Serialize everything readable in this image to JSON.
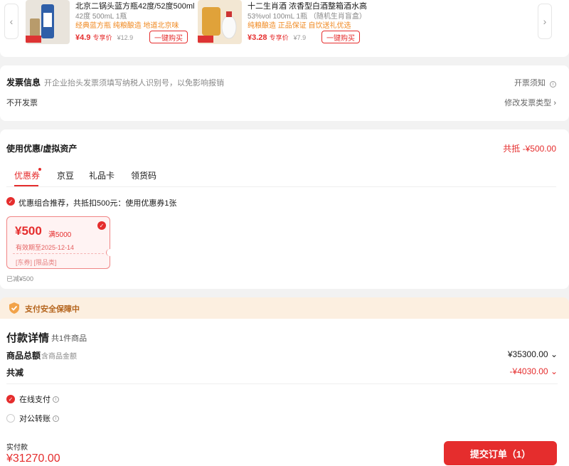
{
  "recommendations": [
    {
      "name": "北京二锅头蓝方瓶42度/52度500ml",
      "spec": "42度 500mL 1瓶",
      "tags": "经典蓝方瓶 纯粮酿造 地道北京味",
      "price": "¥4.9",
      "price_label": "专享价",
      "original_price": "¥12.9",
      "buy_label": "一键购买"
    },
    {
      "name": "十二生肖酒 浓香型白酒整箱酒水高",
      "spec": "53%vol 100mL 1瓶 （随机生肖盲盒）",
      "tags": "纯粮酿造 正品保证 自饮送礼优选",
      "price": "¥3.28",
      "price_label": "专享价",
      "original_price": "¥7.9",
      "buy_label": "一键购买"
    }
  ],
  "invoice": {
    "title": "发票信息",
    "hint": "开企业抬头发票须填写纳税人识别号，以免影响报销",
    "notice": "开票须知",
    "status": "不开发票",
    "modify": "修改发票类型"
  },
  "coupons": {
    "title": "使用优惠/虚拟资产",
    "total_deduction": "共抵 -¥500.00",
    "tabs": [
      "优惠券",
      "京豆",
      "礼品卡",
      "领货码"
    ],
    "recommendation": "优惠组合推荐，共抵扣500元：使用优惠券1张",
    "coupon": {
      "amount": "¥500",
      "condition": "满5000",
      "expiry": "有效期至2025-12-14",
      "tags": "[东券] [限品类]"
    },
    "reduced": "已减¥500"
  },
  "security": {
    "text": "支付安全保障中"
  },
  "payment": {
    "title": "付款详情",
    "count": "共1件商品",
    "total_label": "商品总额",
    "total_sub": "含商品金额",
    "total_value": "¥35300.00",
    "discount_label": "共减",
    "discount_value": "-¥4030.00",
    "options": [
      "在线支付",
      "对公转账"
    ],
    "paid_label": "实付款",
    "paid_value": "¥31270.00",
    "submit": "提交订单（1）"
  },
  "colors": {
    "accent": "#e52d2d",
    "tag_orange": "#f08a22",
    "security_bg": "#fcefe0"
  }
}
